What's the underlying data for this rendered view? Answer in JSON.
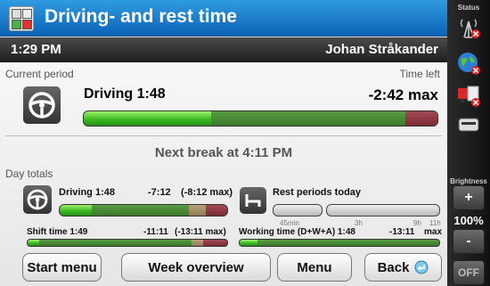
{
  "header": {
    "title": "Driving- and rest time"
  },
  "subbar": {
    "time": "1:29 PM",
    "user": "Johan Stråkander"
  },
  "current_period": {
    "label": "Current period",
    "time_left_label": "Time left",
    "activity": "Driving 1:48",
    "time_left": "-2:42 max",
    "progress": {
      "active": 0.36,
      "remaining": 0.55,
      "over": 0.09
    }
  },
  "next_break": "Next break at 4:11 PM",
  "day_totals": {
    "label": "Day totals",
    "driving": {
      "label": "Driving 1:48",
      "value": "-7:12",
      "max": "(-8:12 max)",
      "progress": {
        "active": 0.19,
        "remaining": 0.58,
        "warn": 0.1,
        "over": 0.13
      }
    },
    "rest": {
      "label": "Rest periods today",
      "ticks": [
        "45min",
        "3h",
        "9h",
        "11h"
      ]
    },
    "shift": {
      "label": "Shift time 1:49",
      "value": "-11:11",
      "max": "(-13:11 max)",
      "progress": {
        "active": 0.06,
        "remaining": 0.76,
        "warn": 0.06,
        "over": 0.12
      }
    },
    "working": {
      "label": "Working time (D+W+A) 1:48",
      "value": "-13:11",
      "max": "max",
      "progress": {
        "active": 0.09,
        "remaining": 0.91
      }
    }
  },
  "buttons": {
    "start_menu": "Start menu",
    "week_overview": "Week overview",
    "menu": "Menu",
    "back": "Back"
  },
  "side": {
    "status_label": "Status",
    "brightness_label": "Brightness",
    "brightness_value": "100%",
    "plus": "+",
    "minus": "-",
    "off": "OFF"
  },
  "icons": [
    "app-icon",
    "steering-wheel-icon",
    "bed-icon",
    "antenna-icon",
    "globe-icon",
    "truck-icon",
    "card-reader-icon",
    "back-arrow-icon"
  ],
  "colors": {
    "title_bar": "#1a7acc",
    "active_bar": "#36b521",
    "over_bar": "#7b2a34"
  }
}
